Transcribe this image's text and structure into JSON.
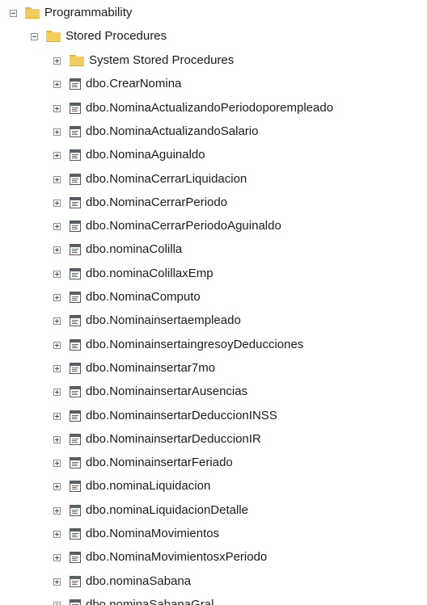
{
  "tree": {
    "root": {
      "label": "Programmability",
      "icon": "folder-icon",
      "expanded": true
    },
    "stored_procedures": {
      "label": "Stored Procedures",
      "icon": "folder-icon",
      "expanded": true
    },
    "items": [
      {
        "label": "System Stored Procedures",
        "icon": "folder-icon"
      },
      {
        "label": "dbo.CrearNomina",
        "icon": "stored-procedure-icon"
      },
      {
        "label": "dbo.NominaActualizandoPeriodoporempleado",
        "icon": "stored-procedure-icon"
      },
      {
        "label": "dbo.NominaActualizandoSalario",
        "icon": "stored-procedure-icon"
      },
      {
        "label": "dbo.NominaAguinaldo",
        "icon": "stored-procedure-icon"
      },
      {
        "label": "dbo.NominaCerrarLiquidacion",
        "icon": "stored-procedure-icon"
      },
      {
        "label": "dbo.NominaCerrarPeriodo",
        "icon": "stored-procedure-icon"
      },
      {
        "label": "dbo.NominaCerrarPeriodoAguinaldo",
        "icon": "stored-procedure-icon"
      },
      {
        "label": "dbo.nominaColilla",
        "icon": "stored-procedure-icon"
      },
      {
        "label": "dbo.nominaColillaxEmp",
        "icon": "stored-procedure-icon"
      },
      {
        "label": "dbo.NominaComputo",
        "icon": "stored-procedure-icon"
      },
      {
        "label": "dbo.Nominainsertaempleado",
        "icon": "stored-procedure-icon"
      },
      {
        "label": "dbo.NominainsertaingresoyDeducciones",
        "icon": "stored-procedure-icon"
      },
      {
        "label": "dbo.Nominainsertar7mo",
        "icon": "stored-procedure-icon"
      },
      {
        "label": "dbo.NominainsertarAusencias",
        "icon": "stored-procedure-icon"
      },
      {
        "label": "dbo.NominainsertarDeduccionINSS",
        "icon": "stored-procedure-icon"
      },
      {
        "label": "dbo.NominainsertarDeduccionIR",
        "icon": "stored-procedure-icon"
      },
      {
        "label": "dbo.NominainsertarFeriado",
        "icon": "stored-procedure-icon"
      },
      {
        "label": "dbo.nominaLiquidacion",
        "icon": "stored-procedure-icon"
      },
      {
        "label": "dbo.nominaLiquidacionDetalle",
        "icon": "stored-procedure-icon"
      },
      {
        "label": "dbo.NominaMovimientos",
        "icon": "stored-procedure-icon"
      },
      {
        "label": "dbo.NominaMovimientosxPeriodo",
        "icon": "stored-procedure-icon"
      },
      {
        "label": "dbo.nominaSabana",
        "icon": "stored-procedure-icon"
      },
      {
        "label": "dbo.nominaSabanaGral",
        "icon": "stored-procedure-icon"
      }
    ]
  }
}
